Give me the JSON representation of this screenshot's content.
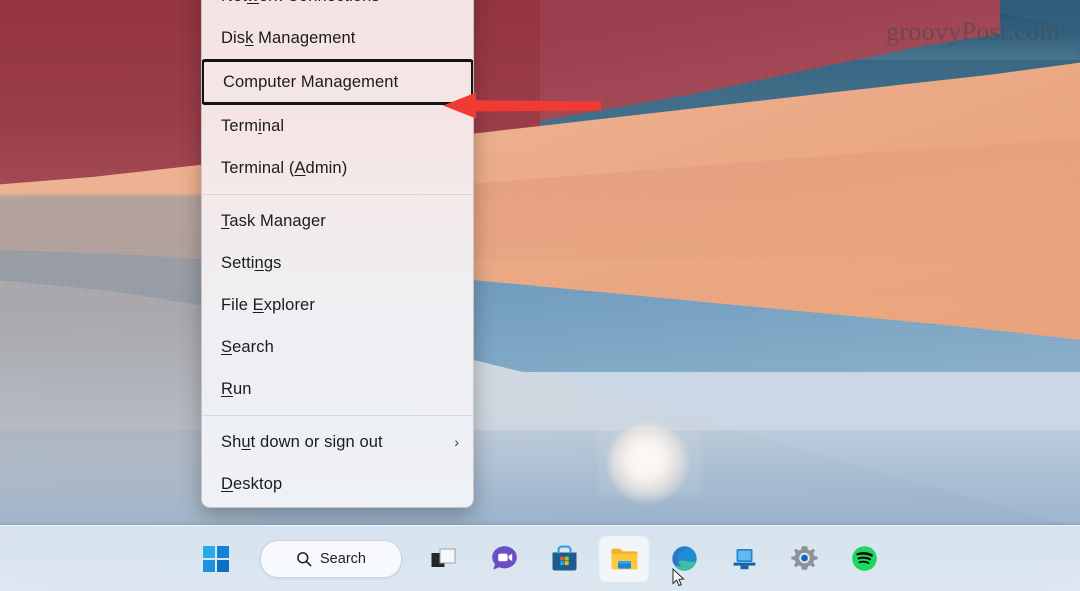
{
  "watermark": "groovyPost.com",
  "context_menu": {
    "name": "win-x-power-user-menu",
    "groups": [
      {
        "items": [
          {
            "label": "Network Connections",
            "accel": "w",
            "pre": "Net",
            "post": "ork Connections",
            "highlighted": false,
            "submenu": false
          },
          {
            "label": "Disk Management",
            "accel": "k",
            "pre": "Dis",
            "post": " Management",
            "highlighted": false,
            "submenu": false
          },
          {
            "label": "Computer Management",
            "accel": "g",
            "pre": "Computer Mana",
            "post": "ement",
            "highlighted": true,
            "submenu": false
          },
          {
            "label": "Terminal",
            "accel": "i",
            "pre": "Term",
            "post": "nal",
            "highlighted": false,
            "submenu": false
          },
          {
            "label": "Terminal (Admin)",
            "accel": "A",
            "pre": "Terminal (",
            "post": "dmin)",
            "highlighted": false,
            "submenu": false
          }
        ]
      },
      {
        "items": [
          {
            "label": "Task Manager",
            "accel": "T",
            "pre": "",
            "post": "ask Manager",
            "highlighted": false,
            "submenu": false
          },
          {
            "label": "Settings",
            "accel": "n",
            "pre": "Setti",
            "post": "gs",
            "highlighted": false,
            "submenu": false
          },
          {
            "label": "File Explorer",
            "accel": "E",
            "pre": "File ",
            "post": "xplorer",
            "highlighted": false,
            "submenu": false
          },
          {
            "label": "Search",
            "accel": "S",
            "pre": "",
            "post": "earch",
            "highlighted": false,
            "submenu": false
          },
          {
            "label": "Run",
            "accel": "R",
            "pre": "",
            "post": "un",
            "highlighted": false,
            "submenu": false
          }
        ]
      },
      {
        "items": [
          {
            "label": "Shut down or sign out",
            "accel": "u",
            "pre": "Sh",
            "post": "t down or sign out",
            "highlighted": false,
            "submenu": true,
            "chevron": "›"
          },
          {
            "label": "Desktop",
            "accel": "D",
            "pre": "",
            "post": "esktop",
            "highlighted": false,
            "submenu": false
          }
        ]
      }
    ]
  },
  "annotation": {
    "type": "red-arrow",
    "points_to": "Computer Management",
    "color": "#ef3b34",
    "highlight_box_color": "#131313"
  },
  "taskbar": {
    "search": {
      "label": "Search",
      "icon": "search-icon"
    },
    "items": [
      {
        "name": "start-button",
        "icon": "windows-logo-icon",
        "label": "Start",
        "active": false
      },
      {
        "name": "task-view-button",
        "icon": "task-view-icon",
        "label": "Task View",
        "active": false
      },
      {
        "name": "chat-button",
        "icon": "chat-teams-icon",
        "label": "Chat",
        "active": false
      },
      {
        "name": "microsoft-store-button",
        "icon": "microsoft-store-icon",
        "label": "Microsoft Store",
        "active": false
      },
      {
        "name": "file-explorer-button",
        "icon": "file-explorer-icon",
        "label": "File Explorer",
        "active": true
      },
      {
        "name": "edge-button",
        "icon": "microsoft-edge-icon",
        "label": "Microsoft Edge",
        "active": false
      },
      {
        "name": "remote-desktop-button",
        "icon": "remote-desktop-icon",
        "label": "Remote Desktop",
        "active": false
      },
      {
        "name": "settings-button",
        "icon": "gear-icon",
        "label": "Settings",
        "active": false
      },
      {
        "name": "spotify-button",
        "icon": "spotify-icon",
        "label": "Spotify",
        "active": false
      }
    ]
  },
  "colors": {
    "wallpaper_maroon": "#9b3b47",
    "wallpaper_peach": "#eeae8b",
    "wallpaper_blue": "#6e9bbd",
    "wallpaper_water": "#ccd5df",
    "menu_background": "#f3e8e8",
    "taskbar_background": "#dfe9f3",
    "annotation_red": "#ef3b34",
    "accent_blue": "#0f7bd4"
  }
}
